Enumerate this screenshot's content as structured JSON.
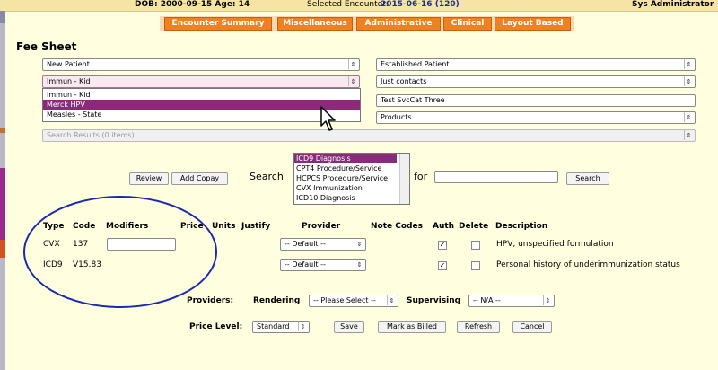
{
  "topbar": {
    "dob": "DOB: 2000-09-15 Age: 14",
    "encounter_label": "Selected Encounter:",
    "encounter_value": "2015-06-16 (120)",
    "user": "Sys Administrator"
  },
  "tabs": [
    "Encounter Summary",
    "Miscellaneous",
    "Administrative",
    "Clinical",
    "Layout Based"
  ],
  "title": "Fee Sheet",
  "selects": {
    "left1": "New Patient",
    "right1": "Established Patient",
    "left2": "Immun - Kid",
    "right2": "Just contacts",
    "right3": "Test SvcCat Three",
    "right4": "Products",
    "search_results": "Search Results (0 items)"
  },
  "popup_items": [
    "Immun - Kid",
    "Merck HPV",
    "Measles - State"
  ],
  "search_bar": {
    "review": "Review",
    "add_copay": "Add Copay",
    "search_label": "Search",
    "for_label": "for",
    "search_button": "Search",
    "code_types": [
      "ICD9 Diagnosis",
      "CPT4 Procedure/Service",
      "HCPCS Procedure/Service",
      "CVX Immunization",
      "ICD10 Diagnosis"
    ]
  },
  "table": {
    "headers": {
      "type": "Type",
      "code": "Code",
      "modifiers": "Modifiers",
      "price": "Price",
      "units": "Units",
      "justify": "Justify",
      "provider": "Provider",
      "note_codes": "Note Codes",
      "auth": "Auth",
      "delete": "Delete",
      "description": "Description"
    },
    "rows": [
      {
        "type": "CVX",
        "code": "137",
        "provider": "-- Default --",
        "auth": true,
        "delete": false,
        "description": "HPV, unspecified formulation"
      },
      {
        "type": "ICD9",
        "code": "V15.83",
        "provider": "-- Default --",
        "auth": true,
        "delete": false,
        "description": "Personal history of underimmunization status"
      }
    ]
  },
  "providers": {
    "label": "Providers:",
    "rendering_label": "Rendering",
    "rendering_value": "-- Please Select --",
    "supervising_label": "Supervising",
    "supervising_value": "-- N/A --"
  },
  "price_level": {
    "label": "Price Level:",
    "value": "Standard",
    "save": "Save",
    "mark_billed": "Mark as Billed",
    "refresh": "Refresh",
    "cancel": "Cancel"
  },
  "colors": {
    "tab_orange": "#f08020",
    "highlight_purple": "#8b2a7a",
    "annotation_blue": "#1a2ab0",
    "background": "#ffffe0"
  }
}
